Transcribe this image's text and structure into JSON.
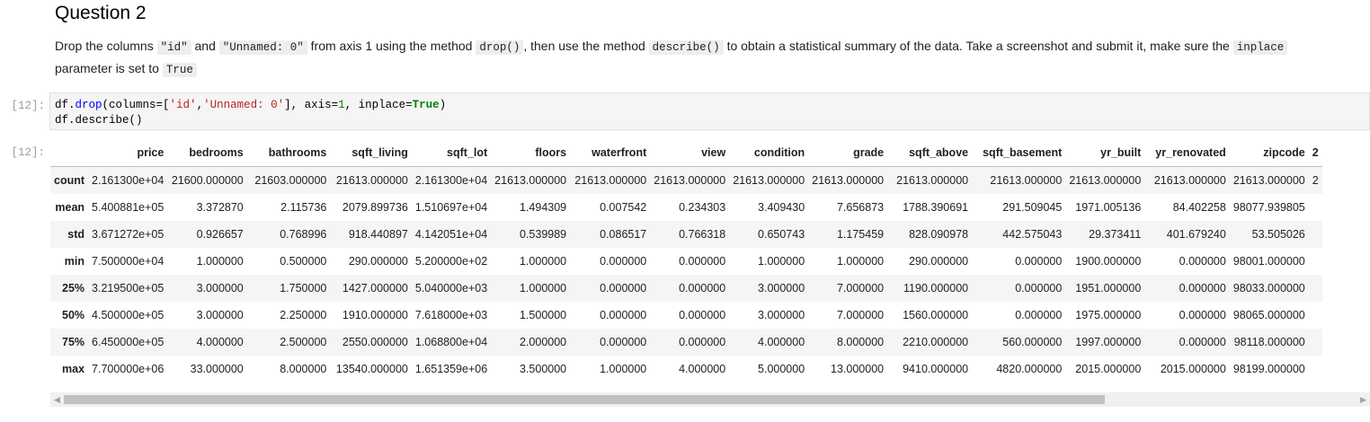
{
  "heading": "Question 2",
  "instructions": {
    "t1": "Drop the columns ",
    "c1": "\"id\"",
    "t2": " and ",
    "c2": "\"Unnamed: 0\"",
    "t3": " from axis 1 using the method ",
    "c3": "drop()",
    "t4": ", then use the method ",
    "c4": "describe()",
    "t5": " to obtain a statistical summary of the data. Take a screenshot and submit it, make sure the ",
    "c5": "inplace",
    "t6": " parameter is set to ",
    "c6": "True"
  },
  "cell": {
    "in_prompt": "[12]:",
    "out_prompt": "[12]:",
    "line1": {
      "a": "df.",
      "fn": "drop",
      "b": "(columns=[",
      "s1": "'id'",
      "c": ",",
      "s2": "'Unnamed: 0'",
      "d": "], axis=",
      "n": "1",
      "e": ", inplace=",
      "kw": "True",
      "f": ")"
    },
    "line2": "df.describe()"
  },
  "table": {
    "columns": [
      "price",
      "bedrooms",
      "bathrooms",
      "sqft_living",
      "sqft_lot",
      "floors",
      "waterfront",
      "view",
      "condition",
      "grade",
      "sqft_above",
      "sqft_basement",
      "yr_built",
      "yr_renovated",
      "zipcode",
      "2"
    ],
    "rows": [
      {
        "label": "count",
        "cells": [
          "2.161300e+04",
          "21600.000000",
          "21603.000000",
          "21613.000000",
          "2.161300e+04",
          "21613.000000",
          "21613.000000",
          "21613.000000",
          "21613.000000",
          "21613.000000",
          "21613.000000",
          "21613.000000",
          "21613.000000",
          "21613.000000",
          "21613.000000",
          "2"
        ]
      },
      {
        "label": "mean",
        "cells": [
          "5.400881e+05",
          "3.372870",
          "2.115736",
          "2079.899736",
          "1.510697e+04",
          "1.494309",
          "0.007542",
          "0.234303",
          "3.409430",
          "7.656873",
          "1788.390691",
          "291.509045",
          "1971.005136",
          "84.402258",
          "98077.939805",
          ""
        ]
      },
      {
        "label": "std",
        "cells": [
          "3.671272e+05",
          "0.926657",
          "0.768996",
          "918.440897",
          "4.142051e+04",
          "0.539989",
          "0.086517",
          "0.766318",
          "0.650743",
          "1.175459",
          "828.090978",
          "442.575043",
          "29.373411",
          "401.679240",
          "53.505026",
          ""
        ]
      },
      {
        "label": "min",
        "cells": [
          "7.500000e+04",
          "1.000000",
          "0.500000",
          "290.000000",
          "5.200000e+02",
          "1.000000",
          "0.000000",
          "0.000000",
          "1.000000",
          "1.000000",
          "290.000000",
          "0.000000",
          "1900.000000",
          "0.000000",
          "98001.000000",
          ""
        ]
      },
      {
        "label": "25%",
        "cells": [
          "3.219500e+05",
          "3.000000",
          "1.750000",
          "1427.000000",
          "5.040000e+03",
          "1.000000",
          "0.000000",
          "0.000000",
          "3.000000",
          "7.000000",
          "1190.000000",
          "0.000000",
          "1951.000000",
          "0.000000",
          "98033.000000",
          ""
        ]
      },
      {
        "label": "50%",
        "cells": [
          "4.500000e+05",
          "3.000000",
          "2.250000",
          "1910.000000",
          "7.618000e+03",
          "1.500000",
          "0.000000",
          "0.000000",
          "3.000000",
          "7.000000",
          "1560.000000",
          "0.000000",
          "1975.000000",
          "0.000000",
          "98065.000000",
          ""
        ]
      },
      {
        "label": "75%",
        "cells": [
          "6.450000e+05",
          "4.000000",
          "2.500000",
          "2550.000000",
          "1.068800e+04",
          "2.000000",
          "0.000000",
          "0.000000",
          "4.000000",
          "8.000000",
          "2210.000000",
          "560.000000",
          "1997.000000",
          "0.000000",
          "98118.000000",
          ""
        ]
      },
      {
        "label": "max",
        "cells": [
          "7.700000e+06",
          "33.000000",
          "8.000000",
          "13540.000000",
          "1.651359e+06",
          "3.500000",
          "1.000000",
          "4.000000",
          "5.000000",
          "13.000000",
          "9410.000000",
          "4820.000000",
          "2015.000000",
          "2015.000000",
          "98199.000000",
          ""
        ]
      }
    ]
  },
  "scrollbar": {
    "left_arrow": "◀",
    "right_arrow": "▶"
  }
}
